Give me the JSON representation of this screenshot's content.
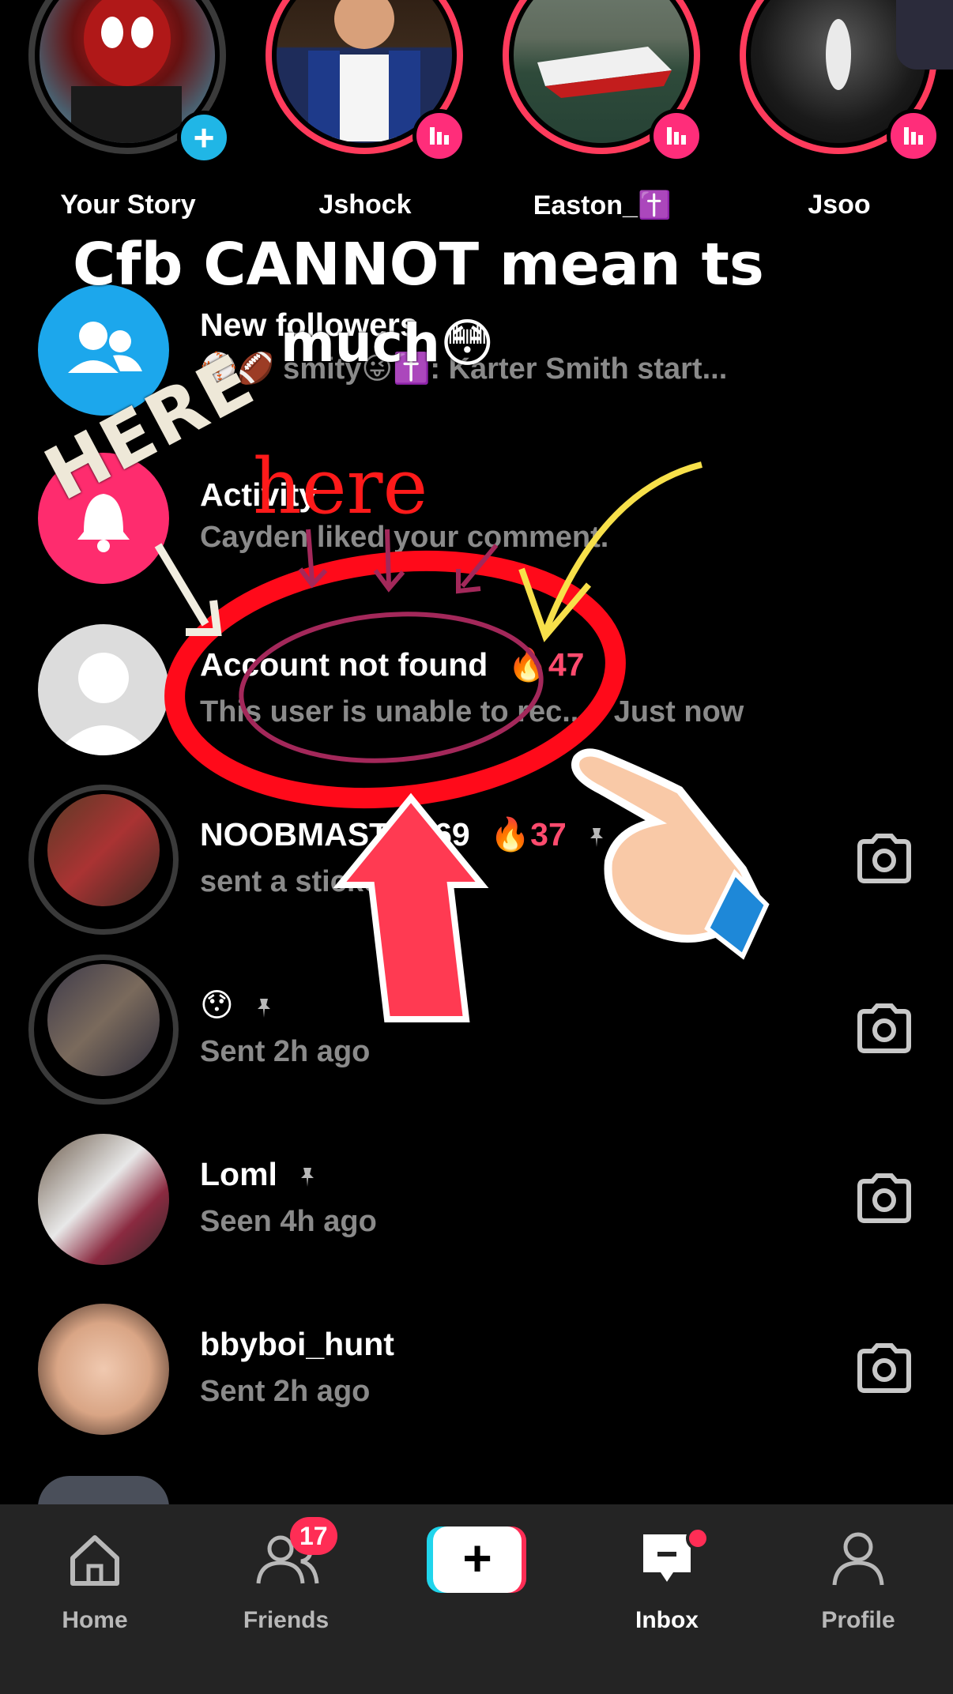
{
  "stories": [
    {
      "name": "Your Story",
      "own": true
    },
    {
      "name": "Jshock",
      "own": false
    },
    {
      "name": "Easton_✝️",
      "own": false
    },
    {
      "name": "Jsoo",
      "own": false
    }
  ],
  "overlay": {
    "caption_line1": "Cfb CANNOT mean ts",
    "caption_line2": "much😳",
    "here_white": "HERE",
    "here_red": "here"
  },
  "rows": [
    {
      "title": "New followers",
      "subtitle": "⚾🏈 smity😜✝️: Karter Smith start..."
    },
    {
      "title": "Activity",
      "subtitle": "Cayden liked your comment."
    },
    {
      "title": "Account not found",
      "streak": "🔥47",
      "subtitle": "This user is unable to rec... · Just now"
    },
    {
      "title": "NOOBMASTER69",
      "streak": "🔥37",
      "subtitle": "sent a sticker 2h"
    },
    {
      "title": "😯",
      "subtitle": "Sent 2h ago"
    },
    {
      "title": "Loml",
      "subtitle": "Seen 4h ago"
    },
    {
      "title": "bbyboi_hunt",
      "subtitle": "Sent 2h ago"
    }
  ],
  "nav": {
    "home": "Home",
    "friends": "Friends",
    "friends_badge": "17",
    "create": "+",
    "inbox": "Inbox",
    "profile": "Profile"
  },
  "colors": {
    "accent_pink": "#ff3b5c",
    "cyan": "#20d5ec",
    "blue_followers": "#1ca7ec",
    "activity_pink": "#fe2c6e"
  }
}
